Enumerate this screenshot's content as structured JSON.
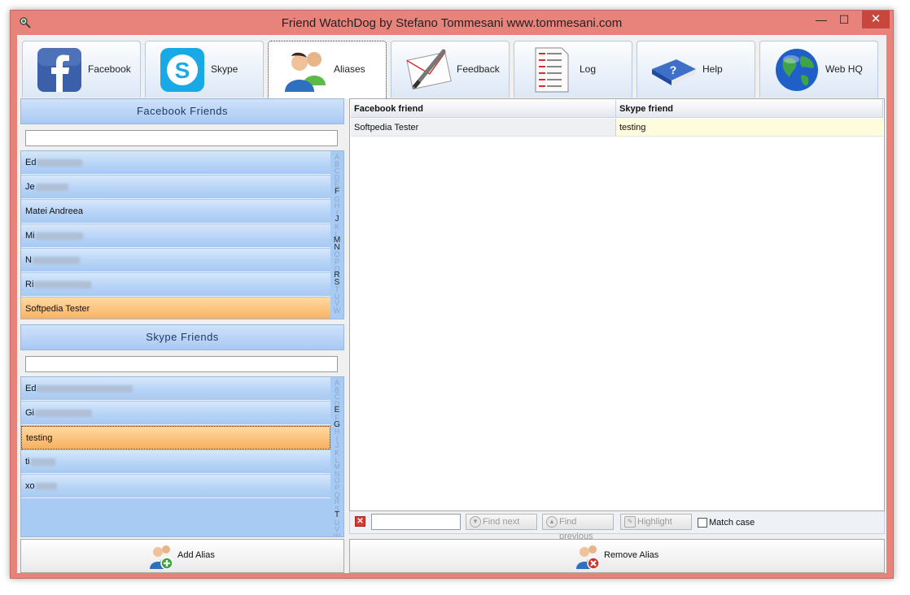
{
  "window": {
    "title": "Friend WatchDog by Stefano Tommesani  www.tommesani.com",
    "controls": {
      "minimize": "—",
      "maximize": "☐",
      "close": "✕"
    }
  },
  "tabs": [
    {
      "label": "Facebook",
      "icon": "facebook-icon",
      "active": false
    },
    {
      "label": "Skype",
      "icon": "skype-icon",
      "active": false
    },
    {
      "label": "Aliases",
      "icon": "users-icon",
      "active": true
    },
    {
      "label": "Feedback",
      "icon": "pen-letter-icon",
      "active": false
    },
    {
      "label": "Log",
      "icon": "log-document-icon",
      "active": false
    },
    {
      "label": "Help",
      "icon": "help-book-icon",
      "active": false
    },
    {
      "label": "Web HQ",
      "icon": "globe-icon",
      "active": false
    }
  ],
  "facebook_friends": {
    "header": "Facebook  Friends",
    "search_value": "",
    "items": [
      {
        "prefix": "Ed",
        "blurred": true,
        "selected": false
      },
      {
        "prefix": "Je",
        "blurred": true,
        "selected": false
      },
      {
        "prefix": "Matei Andreea",
        "blurred": false,
        "selected": false
      },
      {
        "prefix": "Mi",
        "blurred": true,
        "selected": false
      },
      {
        "prefix": "N",
        "blurred": true,
        "selected": false
      },
      {
        "prefix": "Ri",
        "blurred": true,
        "selected": false
      },
      {
        "prefix": "Softpedia Tester",
        "blurred": false,
        "selected": true
      }
    ],
    "alphabet_active": [
      "F",
      "J",
      "M",
      "N",
      "R",
      "S"
    ]
  },
  "skype_friends": {
    "header": "Skype  Friends",
    "search_value": "",
    "items": [
      {
        "prefix": "Ed",
        "blurred": true,
        "selected": false
      },
      {
        "prefix": "Gi",
        "blurred": true,
        "selected": false
      },
      {
        "prefix": "testing",
        "blurred": false,
        "selected": true
      },
      {
        "prefix": "ti",
        "blurred": true,
        "selected": false
      },
      {
        "prefix": "xo",
        "blurred": true,
        "selected": false
      }
    ],
    "alphabet_active": [
      "E",
      "G",
      "T",
      "X"
    ]
  },
  "buttons": {
    "add_alias": "Add Alias",
    "remove_alias": "Remove Alias"
  },
  "aliases_table": {
    "columns": [
      "Facebook friend",
      "Skype friend"
    ],
    "rows": [
      [
        "Softpedia Tester",
        "testing"
      ]
    ]
  },
  "find_bar": {
    "value": "",
    "find_next": "Find next",
    "find_previous": "Find previous",
    "highlight": "Highlight",
    "match_case": "Match case"
  },
  "colors": {
    "frame": "#e8837b",
    "list_blue": "#a8cbf4",
    "selected_orange": "#f7b060",
    "header_blue": "#cfe2fb"
  }
}
